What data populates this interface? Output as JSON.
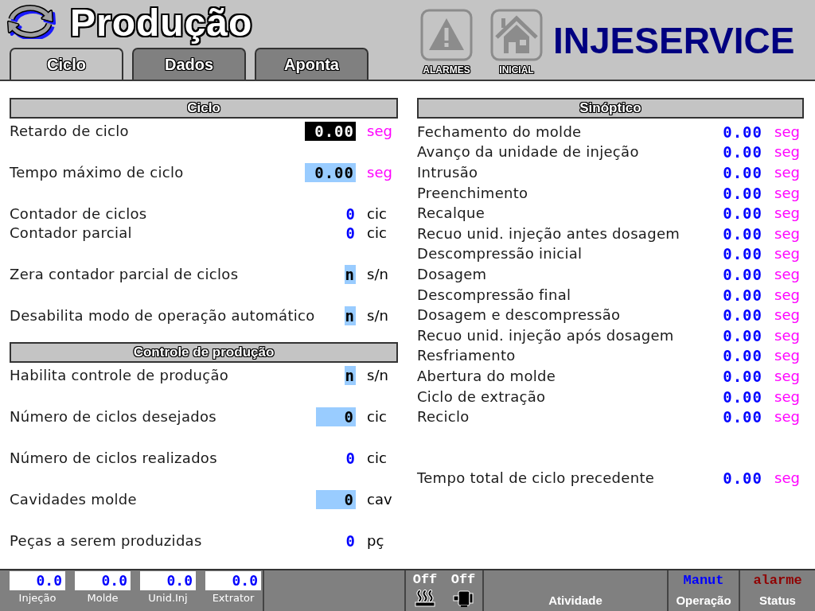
{
  "header": {
    "title": "Produção",
    "tabs": [
      {
        "label": "Ciclo",
        "selected": true
      },
      {
        "label": "Dados",
        "selected": false
      },
      {
        "label": "Aponta",
        "selected": false
      }
    ],
    "shortcuts": [
      {
        "kind": "alarm",
        "label": "ALARMES"
      },
      {
        "kind": "home",
        "label": "INICIAL"
      }
    ],
    "logo": "INJESERVICE"
  },
  "sections": [
    {
      "title": "Ciclo",
      "groups": [
        {
          "rows": [
            {
              "label": "Retardo de ciclo",
              "kind": "field",
              "selected": true,
              "value": "0.00",
              "unit": {
                "text": "seg",
                "color": "#ff00ff"
              }
            }
          ]
        },
        {
          "rows": [
            {
              "label": "Tempo máximo de ciclo",
              "kind": "field",
              "selected": false,
              "value": "0.00",
              "unit": {
                "text": "seg",
                "color": "#ff00ff"
              }
            }
          ]
        },
        {
          "rows": [
            {
              "label": "Contador de ciclos",
              "kind": "readout",
              "selected": false,
              "value": "0",
              "unit": {
                "text": "cic",
                "color": "#000000"
              }
            },
            {
              "label": "Contador parcial",
              "kind": "readout",
              "selected": false,
              "value": "0",
              "unit": {
                "text": "cic",
                "color": "#000000"
              }
            }
          ]
        },
        {
          "rows": [
            {
              "label": "Zera contador parcial de ciclos",
              "kind": "toggle",
              "selected": false,
              "value": "n",
              "unit": {
                "text": "s/n",
                "color": "#000000"
              }
            }
          ]
        },
        {
          "rows": [
            {
              "label": "Desabilita modo de operação automático",
              "kind": "toggle",
              "selected": false,
              "value": "n",
              "unit": {
                "text": "s/n",
                "color": "#000000"
              }
            }
          ]
        }
      ]
    },
    {
      "title": "Controle de produção",
      "groups": [
        {
          "rows": [
            {
              "label": "Habilita controle de produção",
              "kind": "toggle",
              "selected": false,
              "value": "n",
              "unit": {
                "text": "s/n",
                "color": "#000000"
              }
            }
          ]
        },
        {
          "rows": [
            {
              "label": "Número de ciclos desejados",
              "kind": "field",
              "selected": false,
              "value": "0",
              "unit": {
                "text": "cic",
                "color": "#000000"
              }
            }
          ]
        },
        {
          "rows": [
            {
              "label": "Número de ciclos realizados",
              "kind": "readout",
              "selected": false,
              "value": "0",
              "unit": {
                "text": "cic",
                "color": "#000000"
              }
            }
          ]
        },
        {
          "rows": [
            {
              "label": "Cavidades molde",
              "kind": "field",
              "selected": false,
              "value": "0",
              "unit": {
                "text": "cav",
                "color": "#000000"
              }
            }
          ]
        },
        {
          "rows": [
            {
              "label": "Peças a serem produzidas",
              "kind": "readout",
              "selected": false,
              "value": "0",
              "unit": {
                "text": "pç",
                "color": "#000000"
              }
            }
          ]
        }
      ]
    }
  ],
  "synoptic": {
    "title": "Sinóptico",
    "rows": [
      {
        "label": "Fechamento do molde",
        "value": "0.00",
        "unit": "seg"
      },
      {
        "label": "Avanço da unidade de injeção",
        "value": "0.00",
        "unit": "seg"
      },
      {
        "label": "Intrusão",
        "value": "0.00",
        "unit": "seg"
      },
      {
        "label": "Preenchimento",
        "value": "0.00",
        "unit": "seg"
      },
      {
        "label": "Recalque",
        "value": "0.00",
        "unit": "seg"
      },
      {
        "label": "Recuo unid. injeção antes dosagem",
        "value": "0.00",
        "unit": "seg"
      },
      {
        "label": "Descompressão inicial",
        "value": "0.00",
        "unit": "seg"
      },
      {
        "label": "Dosagem",
        "value": "0.00",
        "unit": "seg"
      },
      {
        "label": "Descompressão final",
        "value": "0.00",
        "unit": "seg"
      },
      {
        "label": "Dosagem e descompressão",
        "value": "0.00",
        "unit": "seg"
      },
      {
        "label": "Recuo unid. injeção após dosagem",
        "value": "0.00",
        "unit": "seg"
      },
      {
        "label": "Resfriamento",
        "value": "0.00",
        "unit": "seg"
      },
      {
        "label": "Abertura do molde",
        "value": "0.00",
        "unit": "seg"
      },
      {
        "label": "Ciclo de extração",
        "value": "0.00",
        "unit": "seg"
      },
      {
        "label": "Reciclo",
        "value": "0.00",
        "unit": "seg"
      }
    ],
    "total": {
      "label": "Tempo total de ciclo precedente",
      "value": "0.00",
      "unit": "seg"
    }
  },
  "footer": {
    "readings": [
      {
        "value": "0.0",
        "label": "Injeção"
      },
      {
        "value": "0.0",
        "label": "Molde"
      },
      {
        "value": "0.0",
        "label": "Unid.Inj"
      },
      {
        "value": "0.0",
        "label": "Extrator"
      }
    ],
    "outputs": [
      {
        "kind": "heater",
        "value": "Off"
      },
      {
        "kind": "motor",
        "value": "Off"
      }
    ],
    "activity": {
      "label": "Atividade"
    },
    "operation": {
      "value": "Manut",
      "label": "Operação"
    },
    "status": {
      "value": "alarme",
      "label": "Status"
    }
  }
}
